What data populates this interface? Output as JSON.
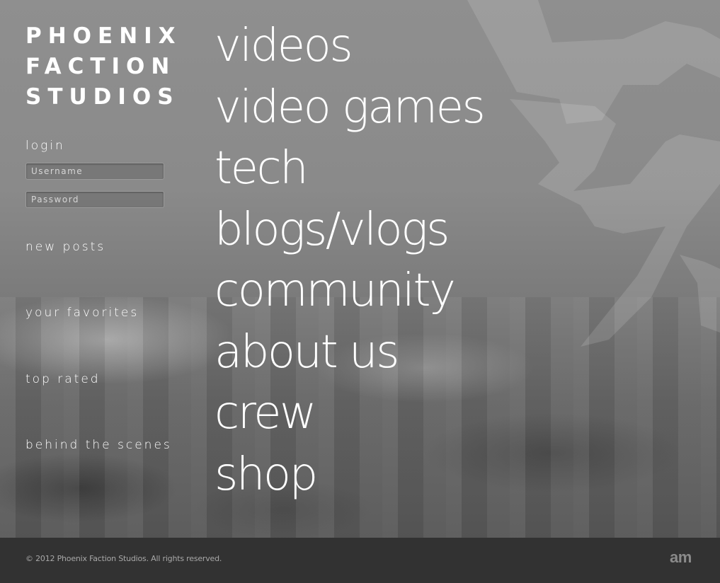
{
  "brand": {
    "line1": "PHOENIX",
    "line2": "FACTION",
    "line3": "STUDIOS"
  },
  "login": {
    "label": "login",
    "username_placeholder": "Username",
    "password_placeholder": "Password"
  },
  "sidebar": {
    "links": [
      "new posts",
      "your favorites",
      "top rated",
      "behind the scenes"
    ]
  },
  "main_nav": {
    "items": [
      "videos",
      "video games",
      "tech",
      "blogs/vlogs",
      "community",
      "about us",
      "crew",
      "shop"
    ]
  },
  "footer": {
    "copyright": "© 2012 Phoenix Faction Studios. All rights reserved.",
    "credit_logo": "am"
  },
  "icons": {
    "background_emblem": "phoenix-icon"
  },
  "colors": {
    "text": "#ffffff",
    "footer_bg": "#323232",
    "footer_text": "#a8a8a8"
  }
}
